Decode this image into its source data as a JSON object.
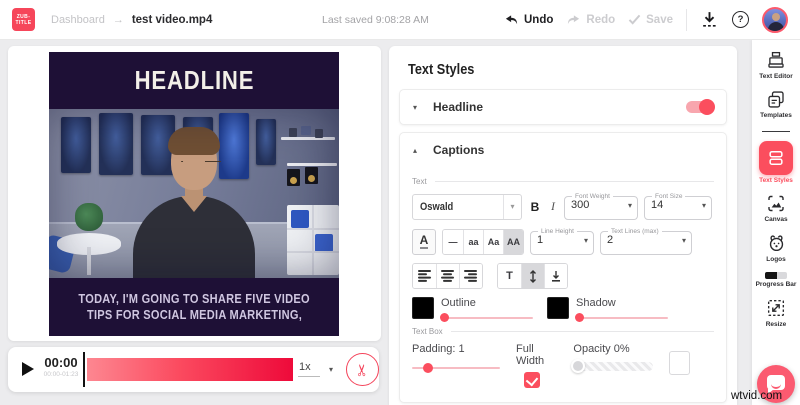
{
  "topbar": {
    "logo_top": "ZUB-",
    "logo_bottom": "TITLE",
    "breadcrumb": {
      "root": "Dashboard",
      "separator": "→",
      "current": "test video.mp4"
    },
    "last_saved": "Last saved 9:08:28 AM",
    "undo_label": "Undo",
    "redo_label": "Redo",
    "save_label": "Save",
    "help_glyph": "?"
  },
  "preview": {
    "headline": "HEADLINE",
    "caption_line1": "TODAY, I'M GOING TO SHARE FIVE VIDEO",
    "caption_line2": "TIPS FOR SOCIAL MEDIA MARKETING,"
  },
  "player": {
    "current_time": "00:00",
    "time_range": "00:00-01:23",
    "speed": "1x"
  },
  "panel": {
    "title": "Text Styles",
    "headline": {
      "label": "Headline",
      "toggle_on": true
    },
    "captions": {
      "label": "Captions",
      "text_group_label": "Text",
      "font_name": "Oswald",
      "bold_label": "B",
      "italic_label": "I",
      "font_weight_label": "Font Weight",
      "font_weight_value": "300",
      "font_size_label": "Font Size",
      "font_size_value": "14",
      "color_button_label": "A",
      "transform_none": "—",
      "transform_lower": "aa",
      "transform_capitalize": "Aa",
      "transform_upper": "AA",
      "line_height_label": "Line Height",
      "line_height_value": "1",
      "text_lines_label": "Text Lines (max)",
      "text_lines_value": "2",
      "valign_top_label": "T",
      "outline_label": "Outline",
      "shadow_label": "Shadow",
      "textbox_group_label": "Text Box",
      "padding_label": "Padding: 1",
      "full_width_label": "Full Width",
      "opacity_label": "Opacity 0%"
    }
  },
  "sidebar": {
    "items": [
      {
        "label": "Text Editor"
      },
      {
        "label": "Templates"
      },
      {
        "label": "Text Styles",
        "active": true
      },
      {
        "label": "Canvas"
      },
      {
        "label": "Logos"
      },
      {
        "label": "Progress Bar"
      },
      {
        "label": "Resize"
      }
    ]
  },
  "watermark": "wtvid.com",
  "colors": {
    "accent": "#fb4e5e",
    "headline_band": "#1e1036",
    "timeline_start": "#fd8791",
    "timeline_end": "#ee0a3a"
  }
}
